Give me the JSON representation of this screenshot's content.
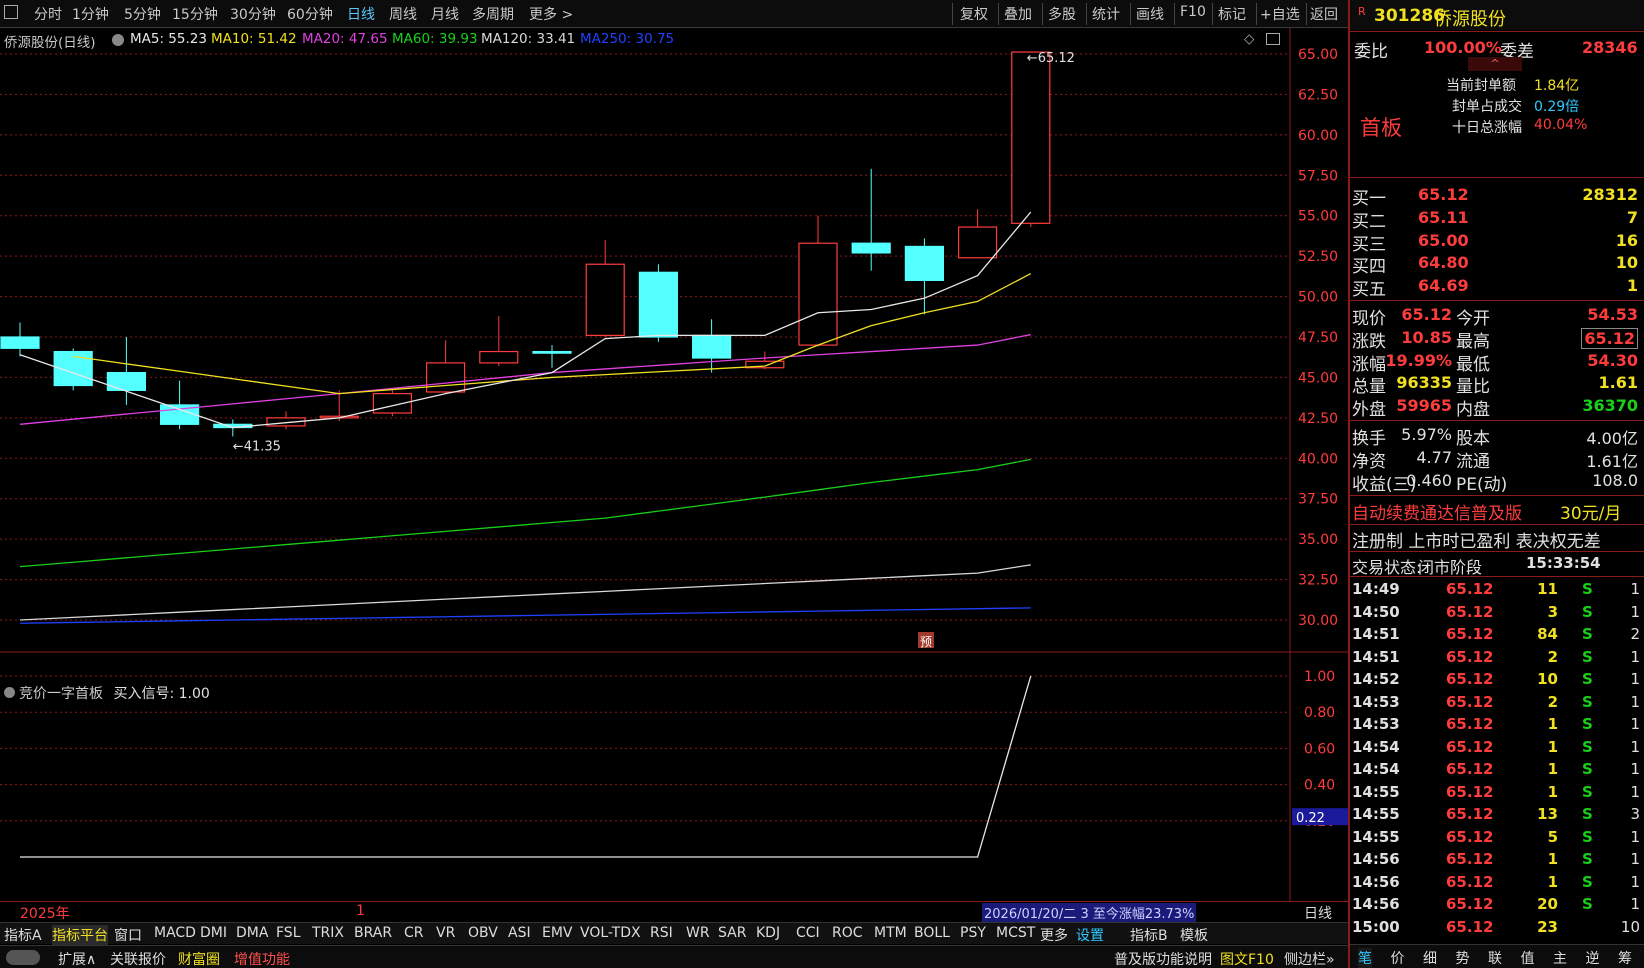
{
  "periods": [
    "分时",
    "1分钟",
    "5分钟",
    "15分钟",
    "30分钟",
    "60分钟",
    "日线",
    "周线",
    "月线",
    "多周期",
    "更多 >"
  ],
  "toolbar": [
    "复权",
    "叠加",
    "多股",
    "统计",
    "画线",
    "F10",
    "标记",
    "+自选",
    "返回"
  ],
  "ma_header": {
    "title": "侨源股份(日线)",
    "ma5": "MA5: 55.23",
    "ma10": "MA10: 51.42",
    "ma20": "MA20: 47.65",
    "ma60": "MA60: 39.93",
    "ma120": "MA120: 33.41",
    "ma250": "MA250: 30.75"
  },
  "colors": {
    "up": "#ff3c3c",
    "down": "#54ffff",
    "ma5": "#e8e8e8",
    "ma10": "#f0e020",
    "ma20": "#e040e0",
    "ma60": "#18d018",
    "ma120": "#d8d8d8",
    "ma250": "#2040ff",
    "grid": "#8b1a1a"
  },
  "price_axis": [
    "65.00",
    "62.50",
    "60.00",
    "57.50",
    "55.00",
    "52.50",
    "50.00",
    "47.50",
    "45.00",
    "42.50",
    "40.00",
    "37.50",
    "35.00",
    "32.50",
    "30.00"
  ],
  "indicator_axis": [
    "1.00",
    "0.80",
    "0.60",
    "0.40",
    "0.20"
  ],
  "chart_data": {
    "type": "candlestick",
    "ylim": [
      29,
      66
    ],
    "candles": [
      {
        "o": 47.5,
        "h": 48.4,
        "l": 46.3,
        "c": 46.8
      },
      {
        "o": 46.6,
        "h": 46.8,
        "l": 44.2,
        "c": 44.5
      },
      {
        "o": 45.3,
        "h": 47.5,
        "l": 43.3,
        "c": 44.2
      },
      {
        "o": 43.3,
        "h": 44.8,
        "l": 41.8,
        "c": 42.1
      },
      {
        "o": 42.1,
        "h": 42.4,
        "l": 41.35,
        "c": 41.9
      },
      {
        "o": 42.0,
        "h": 42.9,
        "l": 41.8,
        "c": 42.5
      },
      {
        "o": 42.5,
        "h": 44.2,
        "l": 42.3,
        "c": 42.6
      },
      {
        "o": 42.8,
        "h": 44.2,
        "l": 42.6,
        "c": 44.0
      },
      {
        "o": 44.1,
        "h": 47.3,
        "l": 44.0,
        "c": 45.9
      },
      {
        "o": 45.9,
        "h": 48.8,
        "l": 45.7,
        "c": 46.6
      },
      {
        "o": 46.6,
        "h": 47.0,
        "l": 45.6,
        "c": 46.5
      },
      {
        "o": 47.6,
        "h": 53.5,
        "l": 47.5,
        "c": 52.0
      },
      {
        "o": 51.5,
        "h": 52.0,
        "l": 47.2,
        "c": 47.5
      },
      {
        "o": 47.6,
        "h": 48.6,
        "l": 45.3,
        "c": 46.2
      },
      {
        "o": 45.6,
        "h": 46.6,
        "l": 45.5,
        "c": 46.0
      },
      {
        "o": 47.0,
        "h": 55.0,
        "l": 46.9,
        "c": 53.3
      },
      {
        "o": 53.3,
        "h": 57.9,
        "l": 51.6,
        "c": 52.7
      },
      {
        "o": 53.1,
        "h": 53.6,
        "l": 48.9,
        "c": 51.0
      },
      {
        "o": 52.4,
        "h": 55.4,
        "l": 52.4,
        "c": 54.3
      },
      {
        "o": 54.53,
        "h": 65.12,
        "l": 54.3,
        "c": 65.12
      }
    ],
    "ma5": [
      46.4,
      null,
      null,
      null,
      41.9,
      null,
      42.5,
      null,
      44.0,
      null,
      45.3,
      47.4,
      47.6,
      47.6,
      47.6,
      49.0,
      49.2,
      49.9,
      51.3,
      55.23
    ],
    "ma10": [
      null,
      46.3,
      null,
      null,
      null,
      null,
      44.0,
      null,
      null,
      null,
      45.0,
      null,
      null,
      null,
      45.7,
      47.0,
      48.2,
      49.0,
      49.7,
      51.42
    ],
    "ma20": [
      42.1,
      null,
      null,
      null,
      null,
      null,
      44.0,
      null,
      null,
      null,
      45.3,
      null,
      null,
      null,
      46.2,
      null,
      46.6,
      null,
      47.0,
      47.65
    ],
    "ma60": [
      33.3,
      null,
      null,
      null,
      null,
      null,
      null,
      null,
      null,
      null,
      null,
      36.3,
      null,
      null,
      37.6,
      null,
      38.5,
      null,
      39.3,
      39.93
    ],
    "ma120": [
      30.0,
      null,
      null,
      null,
      null,
      null,
      null,
      null,
      null,
      null,
      null,
      null,
      null,
      null,
      null,
      null,
      null,
      null,
      32.9,
      33.41
    ],
    "ma250": [
      29.8,
      null,
      null,
      null,
      null,
      null,
      null,
      null,
      null,
      null,
      null,
      null,
      null,
      null,
      null,
      null,
      null,
      null,
      null,
      30.75
    ],
    "annotations": {
      "high": "65.12",
      "low": "41.35"
    },
    "indicator": {
      "name": "竞价一字首板",
      "signal_label": "买入信号: 1.00",
      "values": [
        0,
        0,
        0,
        0,
        0,
        0,
        0,
        0,
        0,
        0,
        0,
        0,
        0,
        0,
        0,
        0,
        0,
        0,
        0,
        1.0
      ],
      "current": "0.22"
    }
  },
  "bottom": {
    "year": "2025年",
    "marker": "1",
    "period_label": "日线",
    "range_note": "2026/01/20/二 3 至今涨幅23.73%"
  },
  "index_tabs": [
    "指标A",
    "指标平台",
    "窗口",
    "MACD",
    "DMI",
    "DMA",
    "FSL",
    "TRIX",
    "BRAR",
    "CR",
    "VR",
    "OBV",
    "ASI",
    "EMV",
    "VOL-TDX",
    "RSI",
    "WR",
    "SAR",
    "KDJ",
    "CCI",
    "ROC",
    "MTM",
    "BOLL",
    "PSY",
    "MCST",
    "更多",
    "设置",
    "指标B",
    "模板"
  ],
  "status_tabs": [
    "扩展∧",
    "关联报价",
    "财富圈",
    "增值功能"
  ],
  "status_right": [
    "普及版功能说明",
    "图文F10",
    "侧边栏»"
  ],
  "right_tabs": [
    "笔",
    "价",
    "细",
    "势",
    "联",
    "值",
    "主",
    "逆",
    "筹"
  ],
  "stock": {
    "code": "301286",
    "name": "侨源股份",
    "weibi_label": "委比",
    "weibi": "100.00%",
    "weicha_label": "委差",
    "weicha": "28346",
    "tag": "首板",
    "seal1_label": "当前封单额",
    "seal1": "1.84亿",
    "seal2_label": "封单占成交",
    "seal2": "0.29倍",
    "seal3_label": "十日总涨幅",
    "seal3": "40.04%",
    "bids": [
      {
        "label": "买一",
        "price": "65.12",
        "vol": "28312"
      },
      {
        "label": "买二",
        "price": "65.11",
        "vol": "7"
      },
      {
        "label": "买三",
        "price": "65.00",
        "vol": "16"
      },
      {
        "label": "买四",
        "price": "64.80",
        "vol": "10"
      },
      {
        "label": "买五",
        "price": "64.69",
        "vol": "1"
      }
    ],
    "quote": [
      [
        "现价",
        "65.12",
        "今开",
        "54.53"
      ],
      [
        "涨跌",
        "10.85",
        "最高",
        "65.12"
      ],
      [
        "涨幅",
        "19.99%",
        "最低",
        "54.30"
      ],
      [
        "总量",
        "96335",
        "量比",
        "1.61"
      ],
      [
        "外盘",
        "59965",
        "内盘",
        "36370"
      ]
    ],
    "info": [
      [
        "换手",
        "5.97%",
        "股本",
        "4.00亿"
      ],
      [
        "净资",
        "4.77",
        "流通",
        "1.61亿"
      ],
      [
        "收益(三)",
        "0.460",
        "PE(动)",
        "108.0"
      ]
    ],
    "ad1": "自动续费通达信普及版",
    "ad1_price": "30元/月",
    "ad2": "注册制 上市时已盈利 表决权无差",
    "status_label": "交易状态:",
    "status": "闭市阶段",
    "status_time": "15:33:54"
  },
  "ticks": [
    [
      "14:49",
      "65.12",
      "11",
      "S",
      "1"
    ],
    [
      "14:50",
      "65.12",
      "3",
      "S",
      "1"
    ],
    [
      "14:51",
      "65.12",
      "84",
      "S",
      "2"
    ],
    [
      "14:51",
      "65.12",
      "2",
      "S",
      "1"
    ],
    [
      "14:52",
      "65.12",
      "10",
      "S",
      "1"
    ],
    [
      "14:53",
      "65.12",
      "2",
      "S",
      "1"
    ],
    [
      "14:53",
      "65.12",
      "1",
      "S",
      "1"
    ],
    [
      "14:54",
      "65.12",
      "1",
      "S",
      "1"
    ],
    [
      "14:54",
      "65.12",
      "1",
      "S",
      "1"
    ],
    [
      "14:55",
      "65.12",
      "1",
      "S",
      "1"
    ],
    [
      "14:55",
      "65.12",
      "13",
      "S",
      "3"
    ],
    [
      "14:55",
      "65.12",
      "5",
      "S",
      "1"
    ],
    [
      "14:56",
      "65.12",
      "1",
      "S",
      "1"
    ],
    [
      "14:56",
      "65.12",
      "1",
      "S",
      "1"
    ],
    [
      "14:56",
      "65.12",
      "20",
      "S",
      "1"
    ],
    [
      "15:00",
      "65.12",
      "23",
      "",
      "10"
    ]
  ]
}
